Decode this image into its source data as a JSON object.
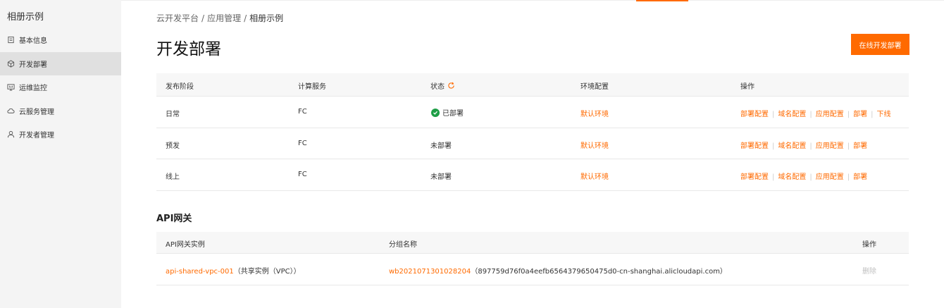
{
  "sidebar": {
    "title": "相册示例",
    "items": [
      {
        "label": "基本信息",
        "icon": "document-icon"
      },
      {
        "label": "开发部署",
        "icon": "cube-icon"
      },
      {
        "label": "运维监控",
        "icon": "monitor-icon"
      },
      {
        "label": "云服务管理",
        "icon": "cloud-icon"
      },
      {
        "label": "开发者管理",
        "icon": "user-icon"
      }
    ],
    "active_index": 1
  },
  "breadcrumb": {
    "items": [
      "云开发平台",
      "应用管理",
      "相册示例"
    ],
    "separator": "/"
  },
  "page_title": "开发部署",
  "primary_button": "在线开发部署",
  "deploy_table": {
    "headers": [
      "发布阶段",
      "计算服务",
      "状态",
      "环境配置",
      "操作"
    ],
    "rows": [
      {
        "stage": "日常",
        "compute": "FC",
        "status": "已部署",
        "env": "默认环境",
        "actions": [
          "部署配置",
          "域名配置",
          "应用配置",
          "部署",
          "下线"
        ]
      },
      {
        "stage": "预发",
        "compute": "FC",
        "status": "未部署",
        "env": "默认环境",
        "actions": [
          "部署配置",
          "域名配置",
          "应用配置",
          "部署"
        ]
      },
      {
        "stage": "线上",
        "compute": "FC",
        "status": "未部署",
        "env": "默认环境",
        "actions": [
          "部署配置",
          "域名配置",
          "应用配置",
          "部署"
        ]
      }
    ]
  },
  "api_section": {
    "title": "API网关",
    "headers": [
      "API网关实例",
      "分组名称",
      "操作"
    ],
    "rows": [
      {
        "instance_link": "api-shared-vpc-001",
        "instance_note": "（共享实例（VPC））",
        "group_link": "wb2021071301028204",
        "group_note": "（897759d76f0a4eefb6564379650475d0-cn-shanghai.alicloudapi.com）",
        "action": "删除"
      }
    ]
  },
  "colors": {
    "accent": "#ff6a00",
    "success": "#1e9e46"
  }
}
